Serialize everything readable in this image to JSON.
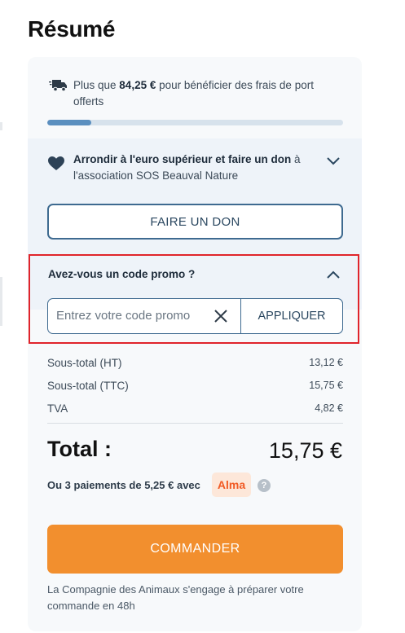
{
  "summary": {
    "title": "Résumé"
  },
  "shipping": {
    "text_before": "Plus que ",
    "amount": "84,25 €",
    "text_after": " pour bénéficier des frais de port offerts",
    "progress_fraction": 0.15
  },
  "donation": {
    "strong_text": "Arrondir à l'euro supérieur et faire un don",
    "rest_text": " à l'association SOS Beauval Nature",
    "button_label": "FAIRE UN DON"
  },
  "promo": {
    "title": "Avez-vous un code promo ?",
    "placeholder": "Entrez votre code promo",
    "value": "",
    "apply_label": "APPLIQUER"
  },
  "totals": {
    "rows": [
      {
        "label": "Sous-total (HT)",
        "value": "13,12 €"
      },
      {
        "label": "Sous-total (TTC)",
        "value": "15,75 €"
      },
      {
        "label": "TVA",
        "value": "4,82 €"
      }
    ],
    "total_label": "Total :",
    "total_value": "15,75 €"
  },
  "alma": {
    "text": "Ou 3 paiements de 5,25 € avec",
    "badge": "Alma",
    "help": "?"
  },
  "order": {
    "button_label": "COMMANDER",
    "footnote": "La Compagnie des Animaux s'engage à préparer votre commande en 48h"
  },
  "colors": {
    "accent": "#f28f2e",
    "primary_border": "#3e6a90",
    "highlight": "#e0242b",
    "alma": "#f15a24"
  }
}
